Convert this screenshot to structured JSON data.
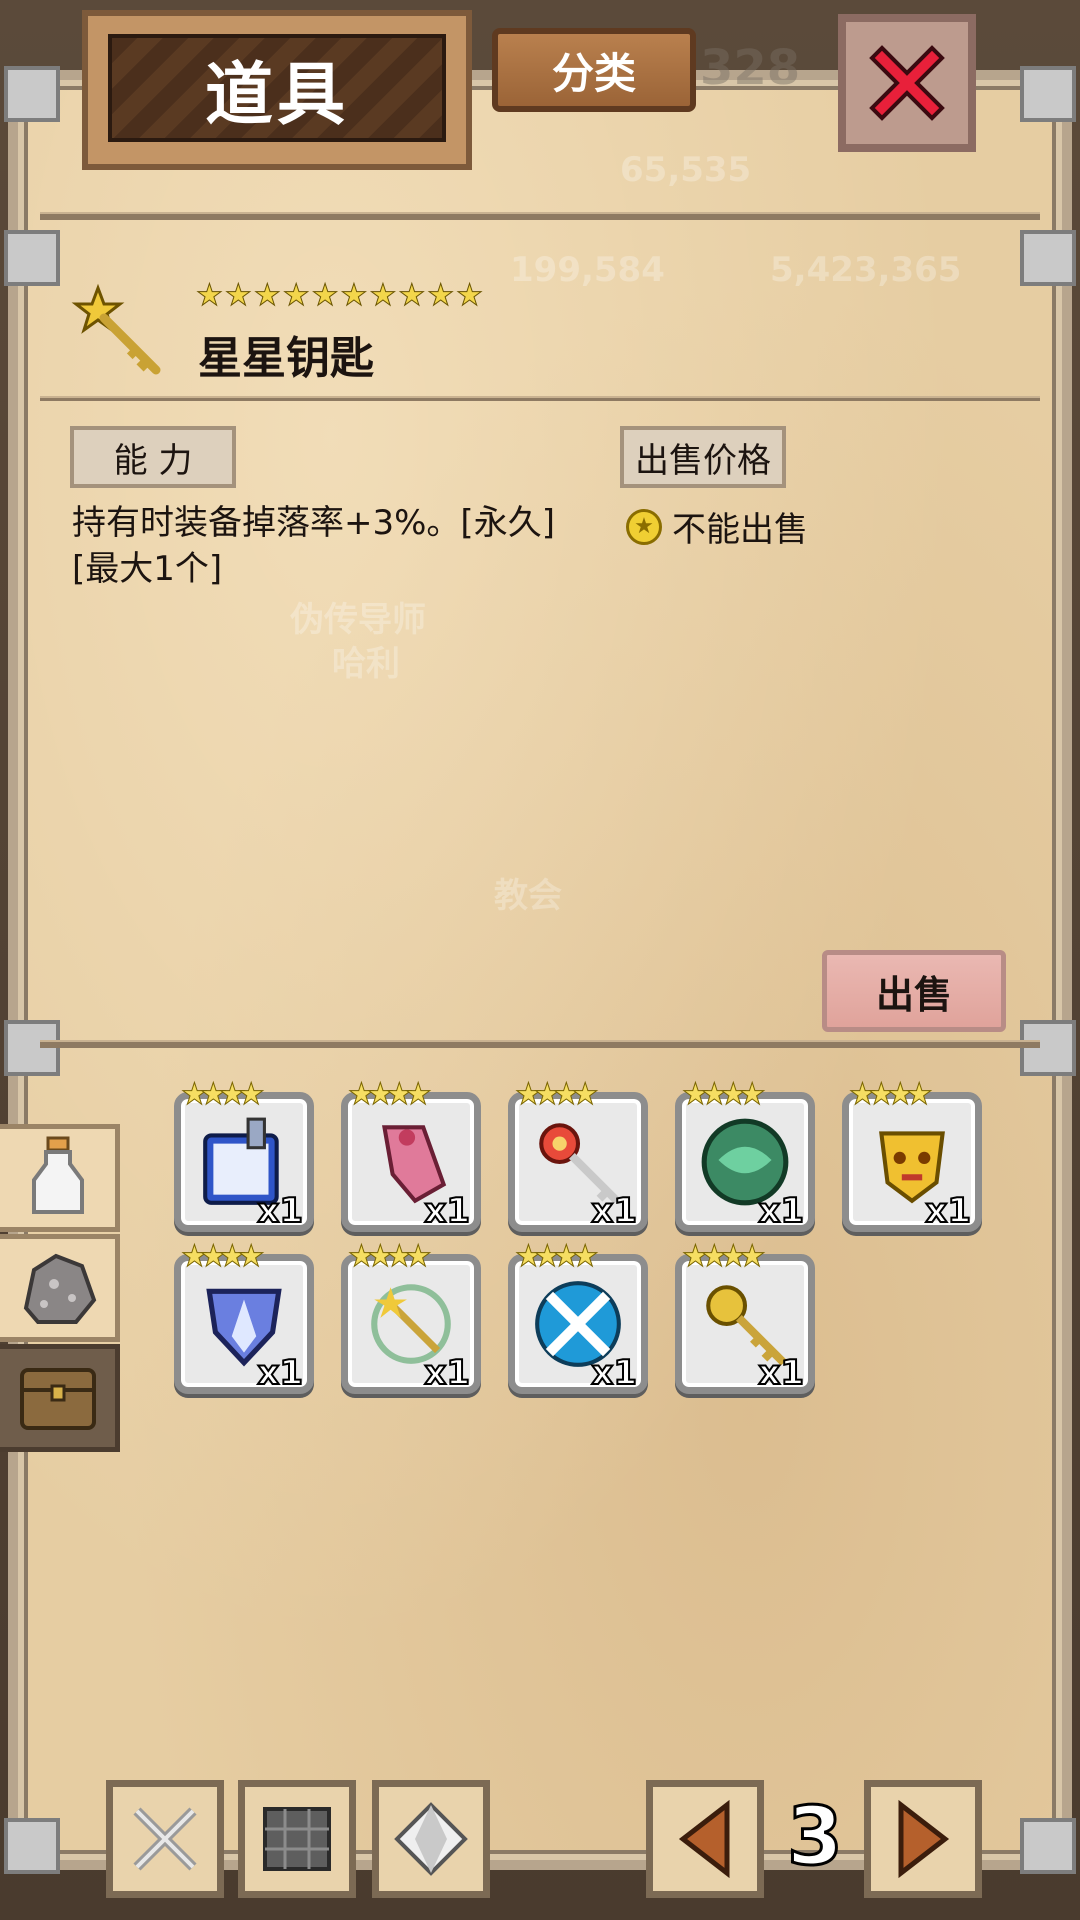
{
  "header": {
    "title": "道具",
    "category_label": "分类",
    "background_number": "328"
  },
  "background_text": {
    "npc_line1": "伪传导师",
    "npc_line2": "哈利",
    "church": "教会",
    "numbers": [
      "65,535",
      "199,584",
      "5,423,365"
    ]
  },
  "item": {
    "name": "星星钥匙",
    "stars": 10,
    "ability_label": "能 力",
    "description_line1": "持有时装备掉落率+3%。[永久]",
    "description_line2": "[最大1个]",
    "price_label": "出售价格",
    "price_value": "不能出售",
    "sell_button": "出售"
  },
  "side_tabs": [
    {
      "icon": "potion-bottle-icon"
    },
    {
      "icon": "ore-rock-icon"
    },
    {
      "icon": "treasure-chest-icon",
      "active": true
    }
  ],
  "inventory": [
    {
      "icon": "spellbook-icon",
      "stars": 4,
      "count": "x1"
    },
    {
      "icon": "pink-cloak-icon",
      "stars": 4,
      "count": "x1"
    },
    {
      "icon": "red-key-icon",
      "stars": 4,
      "count": "x1"
    },
    {
      "icon": "green-orb-icon",
      "stars": 4,
      "count": "x1"
    },
    {
      "icon": "golden-mask-icon",
      "stars": 4,
      "count": "x1"
    },
    {
      "icon": "blue-shield-icon",
      "stars": 4,
      "count": "x1"
    },
    {
      "icon": "ring-key-icon",
      "stars": 4,
      "count": "x1"
    },
    {
      "icon": "crossed-swords-icon",
      "stars": 4,
      "count": "x1"
    },
    {
      "icon": "gold-key-icon",
      "stars": 4,
      "count": "x1"
    }
  ],
  "footer": {
    "page": "3",
    "buttons": [
      "swords-filter-icon",
      "armor-filter-icon",
      "gem-filter-icon"
    ]
  },
  "colors": {
    "parchment": "#e6cda2",
    "star": "#f3d64b",
    "close_red": "#e8203a"
  }
}
